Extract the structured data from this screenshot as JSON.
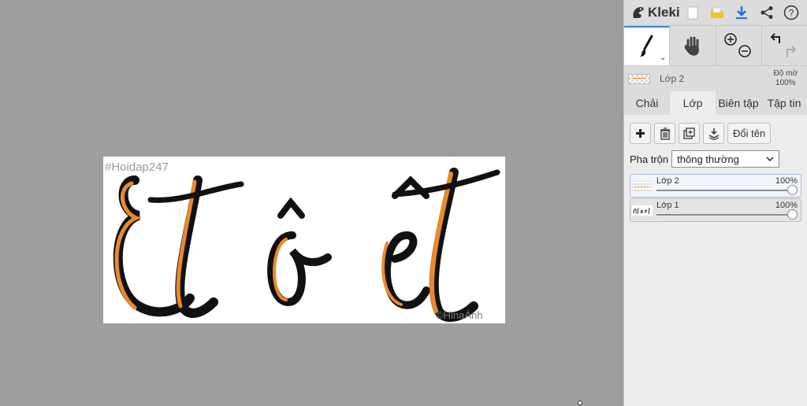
{
  "app": {
    "name": "Kleki",
    "top_icons": [
      "new-file-icon",
      "open-folder-icon",
      "download-icon",
      "share-icon",
      "help-icon"
    ]
  },
  "canvas": {
    "watermark_left": "#Hoidap247",
    "watermark_right": "©HinaÁnh",
    "main_text": "Et ô êt",
    "colors": {
      "ink": "#111111",
      "accent": "#e88b2a",
      "background": "#ffffff"
    }
  },
  "tools": [
    {
      "name": "brush",
      "icon": "brush-icon",
      "active": true
    },
    {
      "name": "hand",
      "icon": "hand-icon",
      "active": false
    },
    {
      "name": "zoom",
      "icon": "zoom-icon",
      "active": false
    },
    {
      "name": "undo-redo",
      "icon": "undo-redo-icon",
      "active": false
    }
  ],
  "current_layer": {
    "name": "Lớp 2",
    "opacity_label": "Độ mờ",
    "opacity_value": "100%"
  },
  "tabs": [
    {
      "label": "Chải",
      "active": false
    },
    {
      "label": "Lớp",
      "active": true
    },
    {
      "label": "Biên tập",
      "active": false
    },
    {
      "label": "Tập tin",
      "active": false
    }
  ],
  "layer_panel": {
    "rename_label": "Đổi tên",
    "blend_label": "Pha trộn",
    "blend_value": "thông thường",
    "layers": [
      {
        "name": "Lớp 2",
        "opacity": "100%",
        "selected": true
      },
      {
        "name": "Lớp 1",
        "opacity": "100%",
        "selected": false
      }
    ]
  },
  "accent_color": "#3a86e8"
}
